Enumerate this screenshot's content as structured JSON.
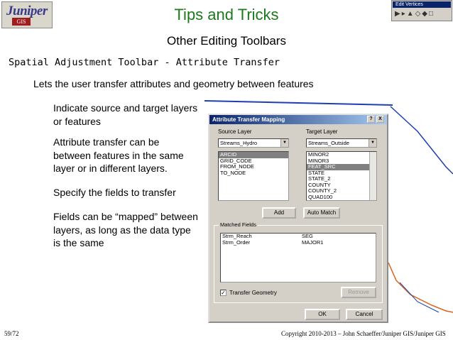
{
  "logo": {
    "word": "Juniper",
    "gis": "GIS"
  },
  "title": "Tips and Tricks",
  "subtitle": "Other Editing Toolbars",
  "section": "Spatial Adjustment Toolbar - Attribute Transfer",
  "lead": "Lets the user transfer attributes and geometry between features",
  "bullets": [
    "Indicate source and target layers or features",
    "Attribute transfer can be between features in the same layer or in different layers.",
    "Specify the fields to transfer",
    "Fields can be “mapped” between layers, as long as the data type is the same"
  ],
  "edit_vertices_toolbar": {
    "title": "Edit Vertices"
  },
  "dialog": {
    "title": "Attribute Transfer Mapping",
    "help": "?",
    "close": "X",
    "source_layer_label": "Source Layer",
    "target_layer_label": "Target Layer",
    "source_layer_value": "Streams_Hydro",
    "target_layer_value": "Streams_Outside",
    "source_fields": [
      "ARCID",
      "GRID_CODE",
      "FROM_NODE",
      "TO_NODE"
    ],
    "target_fields": [
      "MINOR2",
      "MINOR3",
      "FEAT_SRC",
      "STATE",
      "STATE_2",
      "COUNTY",
      "COUNTY_2",
      "QUAD100"
    ],
    "add_label": "Add",
    "auto_match_label": "Auto Match",
    "matched_fields_label": "Matched Fields",
    "matched": [
      {
        "source": "Strm_Reach",
        "target": "SEG"
      },
      {
        "source": "Strm_Order",
        "target": "MAJOR1"
      }
    ],
    "transfer_geometry_label": "Transfer Geometry",
    "transfer_geometry_checked": true,
    "remove_label": "Remove",
    "ok_label": "OK",
    "cancel_label": "Cancel"
  },
  "footer": {
    "page": "59/72",
    "copyright": "Copyright 2010-2013 – John Schaeffer/Juniper GIS/Juniper GIS"
  },
  "colors": {
    "title": "#1b7a1b",
    "map_line_blue": "#1f3fb0",
    "map_line_orange": "#d9621c"
  }
}
